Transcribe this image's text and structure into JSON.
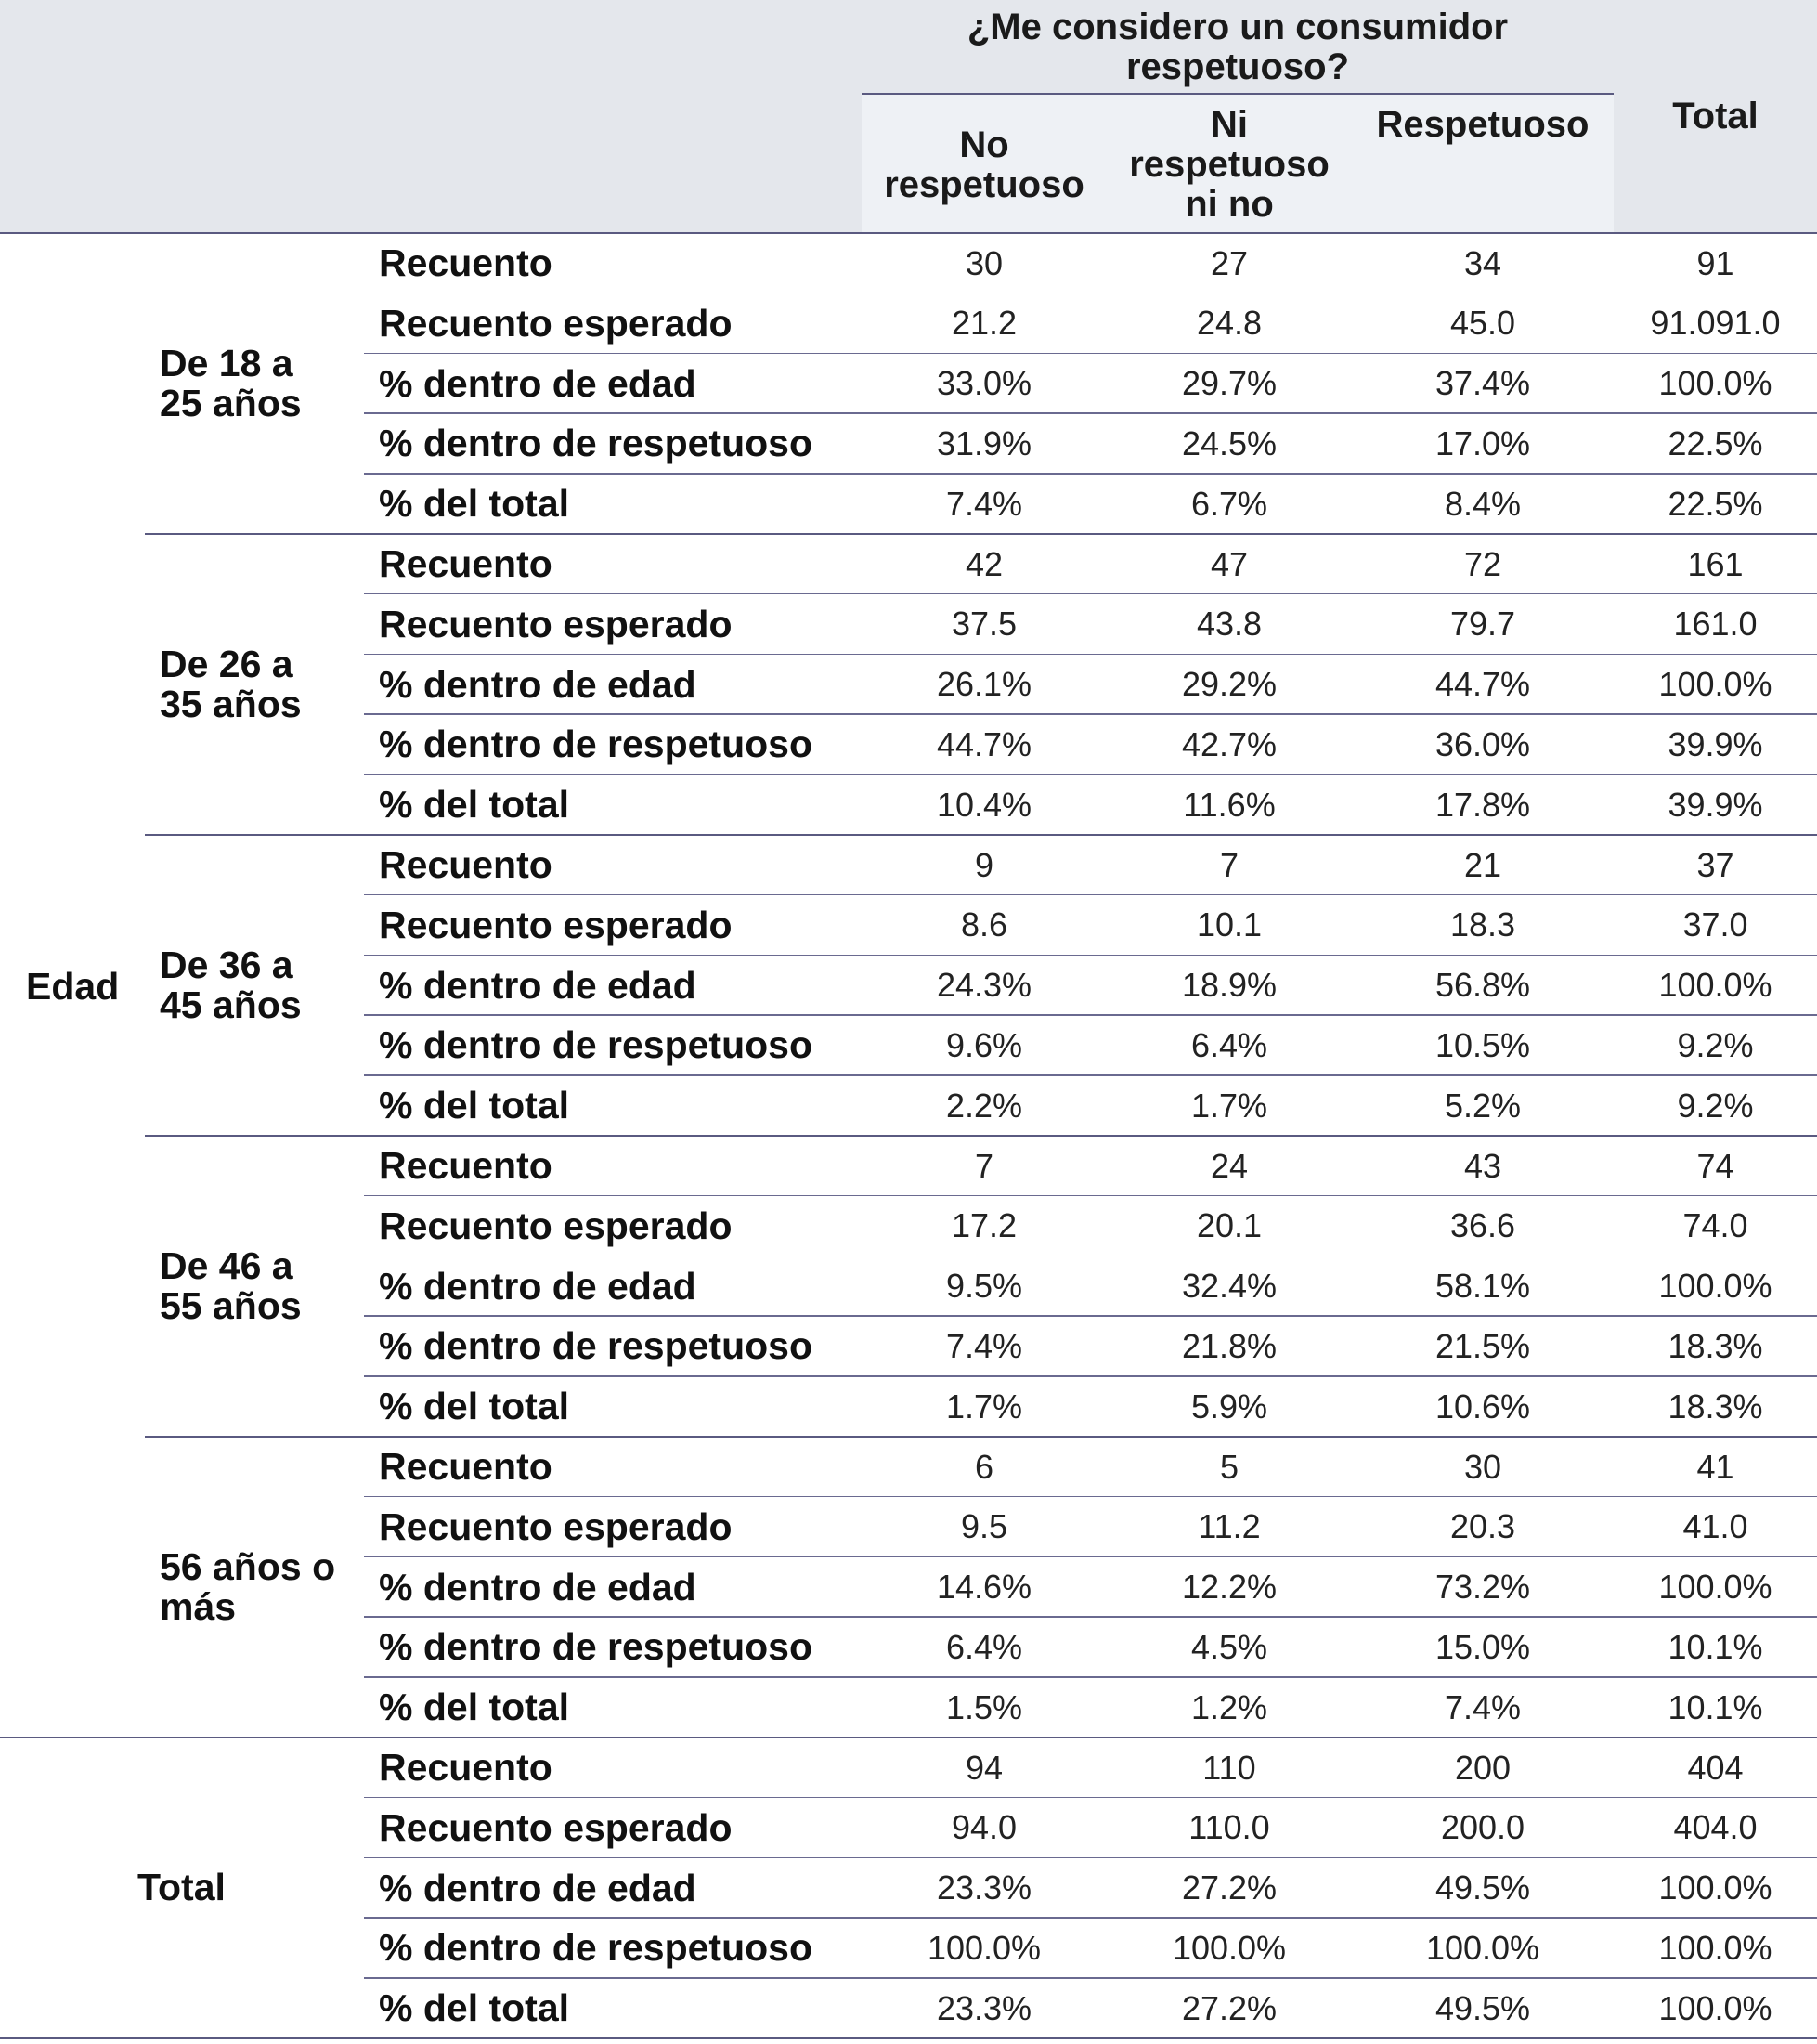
{
  "header": {
    "span_label": "¿Me considero un consumidor respetuoso?",
    "columns": [
      "No\nrespetuoso",
      "Ni\nrespetuoso\nni no",
      "Respetuoso"
    ],
    "total_label": "Total"
  },
  "row_var_label": "Edad",
  "stat_labels": [
    "Recuento",
    "Recuento esperado",
    "% dentro de edad",
    "% dentro de respetuoso",
    "% del total"
  ],
  "groups": [
    {
      "label": "De 18 a\n25 años",
      "rows": [
        [
          "30",
          "27",
          "34",
          "91"
        ],
        [
          "21.2",
          "24.8",
          "45.0",
          "91.091.0"
        ],
        [
          "33.0%",
          "29.7%",
          "37.4%",
          "100.0%"
        ],
        [
          "31.9%",
          "24.5%",
          "17.0%",
          "22.5%"
        ],
        [
          "7.4%",
          "6.7%",
          "8.4%",
          "22.5%"
        ]
      ]
    },
    {
      "label": "De 26 a\n35 años",
      "rows": [
        [
          "42",
          "47",
          "72",
          "161"
        ],
        [
          "37.5",
          "43.8",
          "79.7",
          "161.0"
        ],
        [
          "26.1%",
          "29.2%",
          "44.7%",
          "100.0%"
        ],
        [
          "44.7%",
          "42.7%",
          "36.0%",
          "39.9%"
        ],
        [
          "10.4%",
          "11.6%",
          "17.8%",
          "39.9%"
        ]
      ]
    },
    {
      "label": "De 36 a\n45 años",
      "rows": [
        [
          "9",
          "7",
          "21",
          "37"
        ],
        [
          "8.6",
          "10.1",
          "18.3",
          "37.0"
        ],
        [
          "24.3%",
          "18.9%",
          "56.8%",
          "100.0%"
        ],
        [
          "9.6%",
          "6.4%",
          "10.5%",
          "9.2%"
        ],
        [
          "2.2%",
          "1.7%",
          "5.2%",
          "9.2%"
        ]
      ]
    },
    {
      "label": "De 46 a\n55 años",
      "rows": [
        [
          "7",
          "24",
          "43",
          "74"
        ],
        [
          "17.2",
          "20.1",
          "36.6",
          "74.0"
        ],
        [
          "9.5%",
          "32.4%",
          "58.1%",
          "100.0%"
        ],
        [
          "7.4%",
          "21.8%",
          "21.5%",
          "18.3%"
        ],
        [
          "1.7%",
          "5.9%",
          "10.6%",
          "18.3%"
        ]
      ]
    },
    {
      "label": "56 años o\nmás",
      "rows": [
        [
          "6",
          "5",
          "30",
          "41"
        ],
        [
          "9.5",
          "11.2",
          "20.3",
          "41.0"
        ],
        [
          "14.6%",
          "12.2%",
          "73.2%",
          "100.0%"
        ],
        [
          "6.4%",
          "4.5%",
          "15.0%",
          "10.1%"
        ],
        [
          "1.5%",
          "1.2%",
          "7.4%",
          "10.1%"
        ]
      ]
    }
  ],
  "total_group": {
    "label": "Total",
    "rows": [
      [
        "94",
        "110",
        "200",
        "404"
      ],
      [
        "94.0",
        "110.0",
        "200.0",
        "404.0"
      ],
      [
        "23.3%",
        "27.2%",
        "49.5%",
        "100.0%"
      ],
      [
        "100.0%",
        "100.0%",
        "100.0%",
        "100.0%"
      ],
      [
        "23.3%",
        "27.2%",
        "49.5%",
        "100.0%"
      ]
    ]
  }
}
